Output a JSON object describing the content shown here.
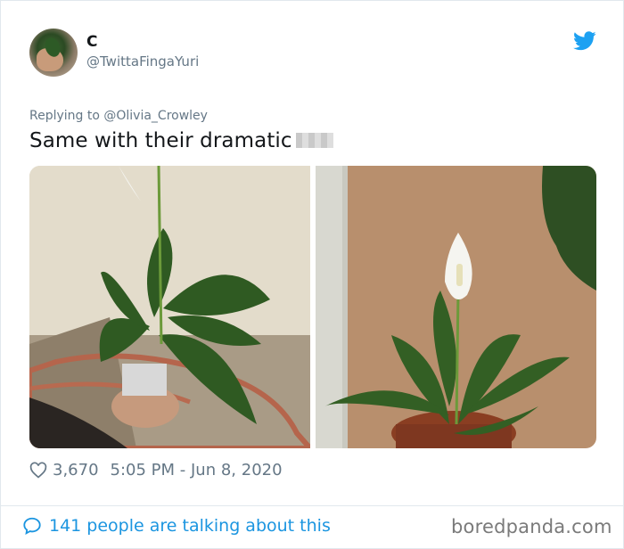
{
  "tweet": {
    "display_name": "C",
    "handle": "@TwittaFingaYuri",
    "replying_to": "Replying to @Olivia_Crowley",
    "text": "Same with their dramatic",
    "likes": "3,670",
    "timestamp": "5:05 PM - Jun 8, 2020",
    "conversation": "141 people are talking about this"
  },
  "watermark": "boredpanda.com",
  "colors": {
    "twitter_blue": "#1da1f2",
    "link_blue": "#1b95e0",
    "secondary_text": "#657786",
    "border": "#e1e8ed"
  },
  "icons": {
    "brand": "twitter-bird-icon",
    "like": "heart-outline-icon",
    "conversation": "speech-bubble-icon"
  }
}
